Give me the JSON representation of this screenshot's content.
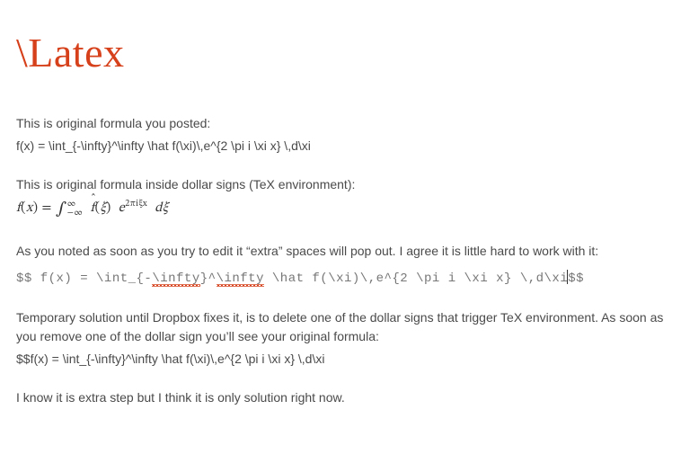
{
  "title": "\\Latex",
  "p1_label": "This is original formula you posted:",
  "p1_formula_raw": "f(x) = \\int_{-\\infty}^\\infty \\hat f(\\xi)\\,e^{2 \\pi i \\xi x} \\,d\\xi",
  "p2_label": "This is original formula inside dollar signs (TeX environment):",
  "p2_rendered": {
    "full_tex": "f(x) = \\int_{-\\infty}^{\\infty} \\hat f(\\xi) e^{2\\pi i \\xi x} d\\xi"
  },
  "p3_text": "As you noted as soon as you try to edit it “extra” spaces will pop out. I agree it is little hard to work with it:",
  "p3_code": {
    "seg1": "$$ f(x)  =  \\int_{-",
    "seg2_squiggle": "\\infty",
    "seg3": "}^",
    "seg4_squiggle": "\\infty",
    "seg5": " \\hat f(\\xi)\\,e^{2 \\pi i \\xi x}  \\,d\\xi",
    "seg6": "$$"
  },
  "p4_text": "Temporary solution until Dropbox fixes it, is to delete one of the dollar signs that trigger TeX environment. As soon as you remove one of the dollar sign you’ll see your original formula:",
  "p4_formula_raw": "$$f(x) = \\int_{-\\infty}^\\infty \\hat f(\\xi)\\,e^{2 \\pi i \\xi x} \\,d\\xi",
  "p5_text": "I know it is extra step but I think it is only solution right now.",
  "chart_data": null
}
